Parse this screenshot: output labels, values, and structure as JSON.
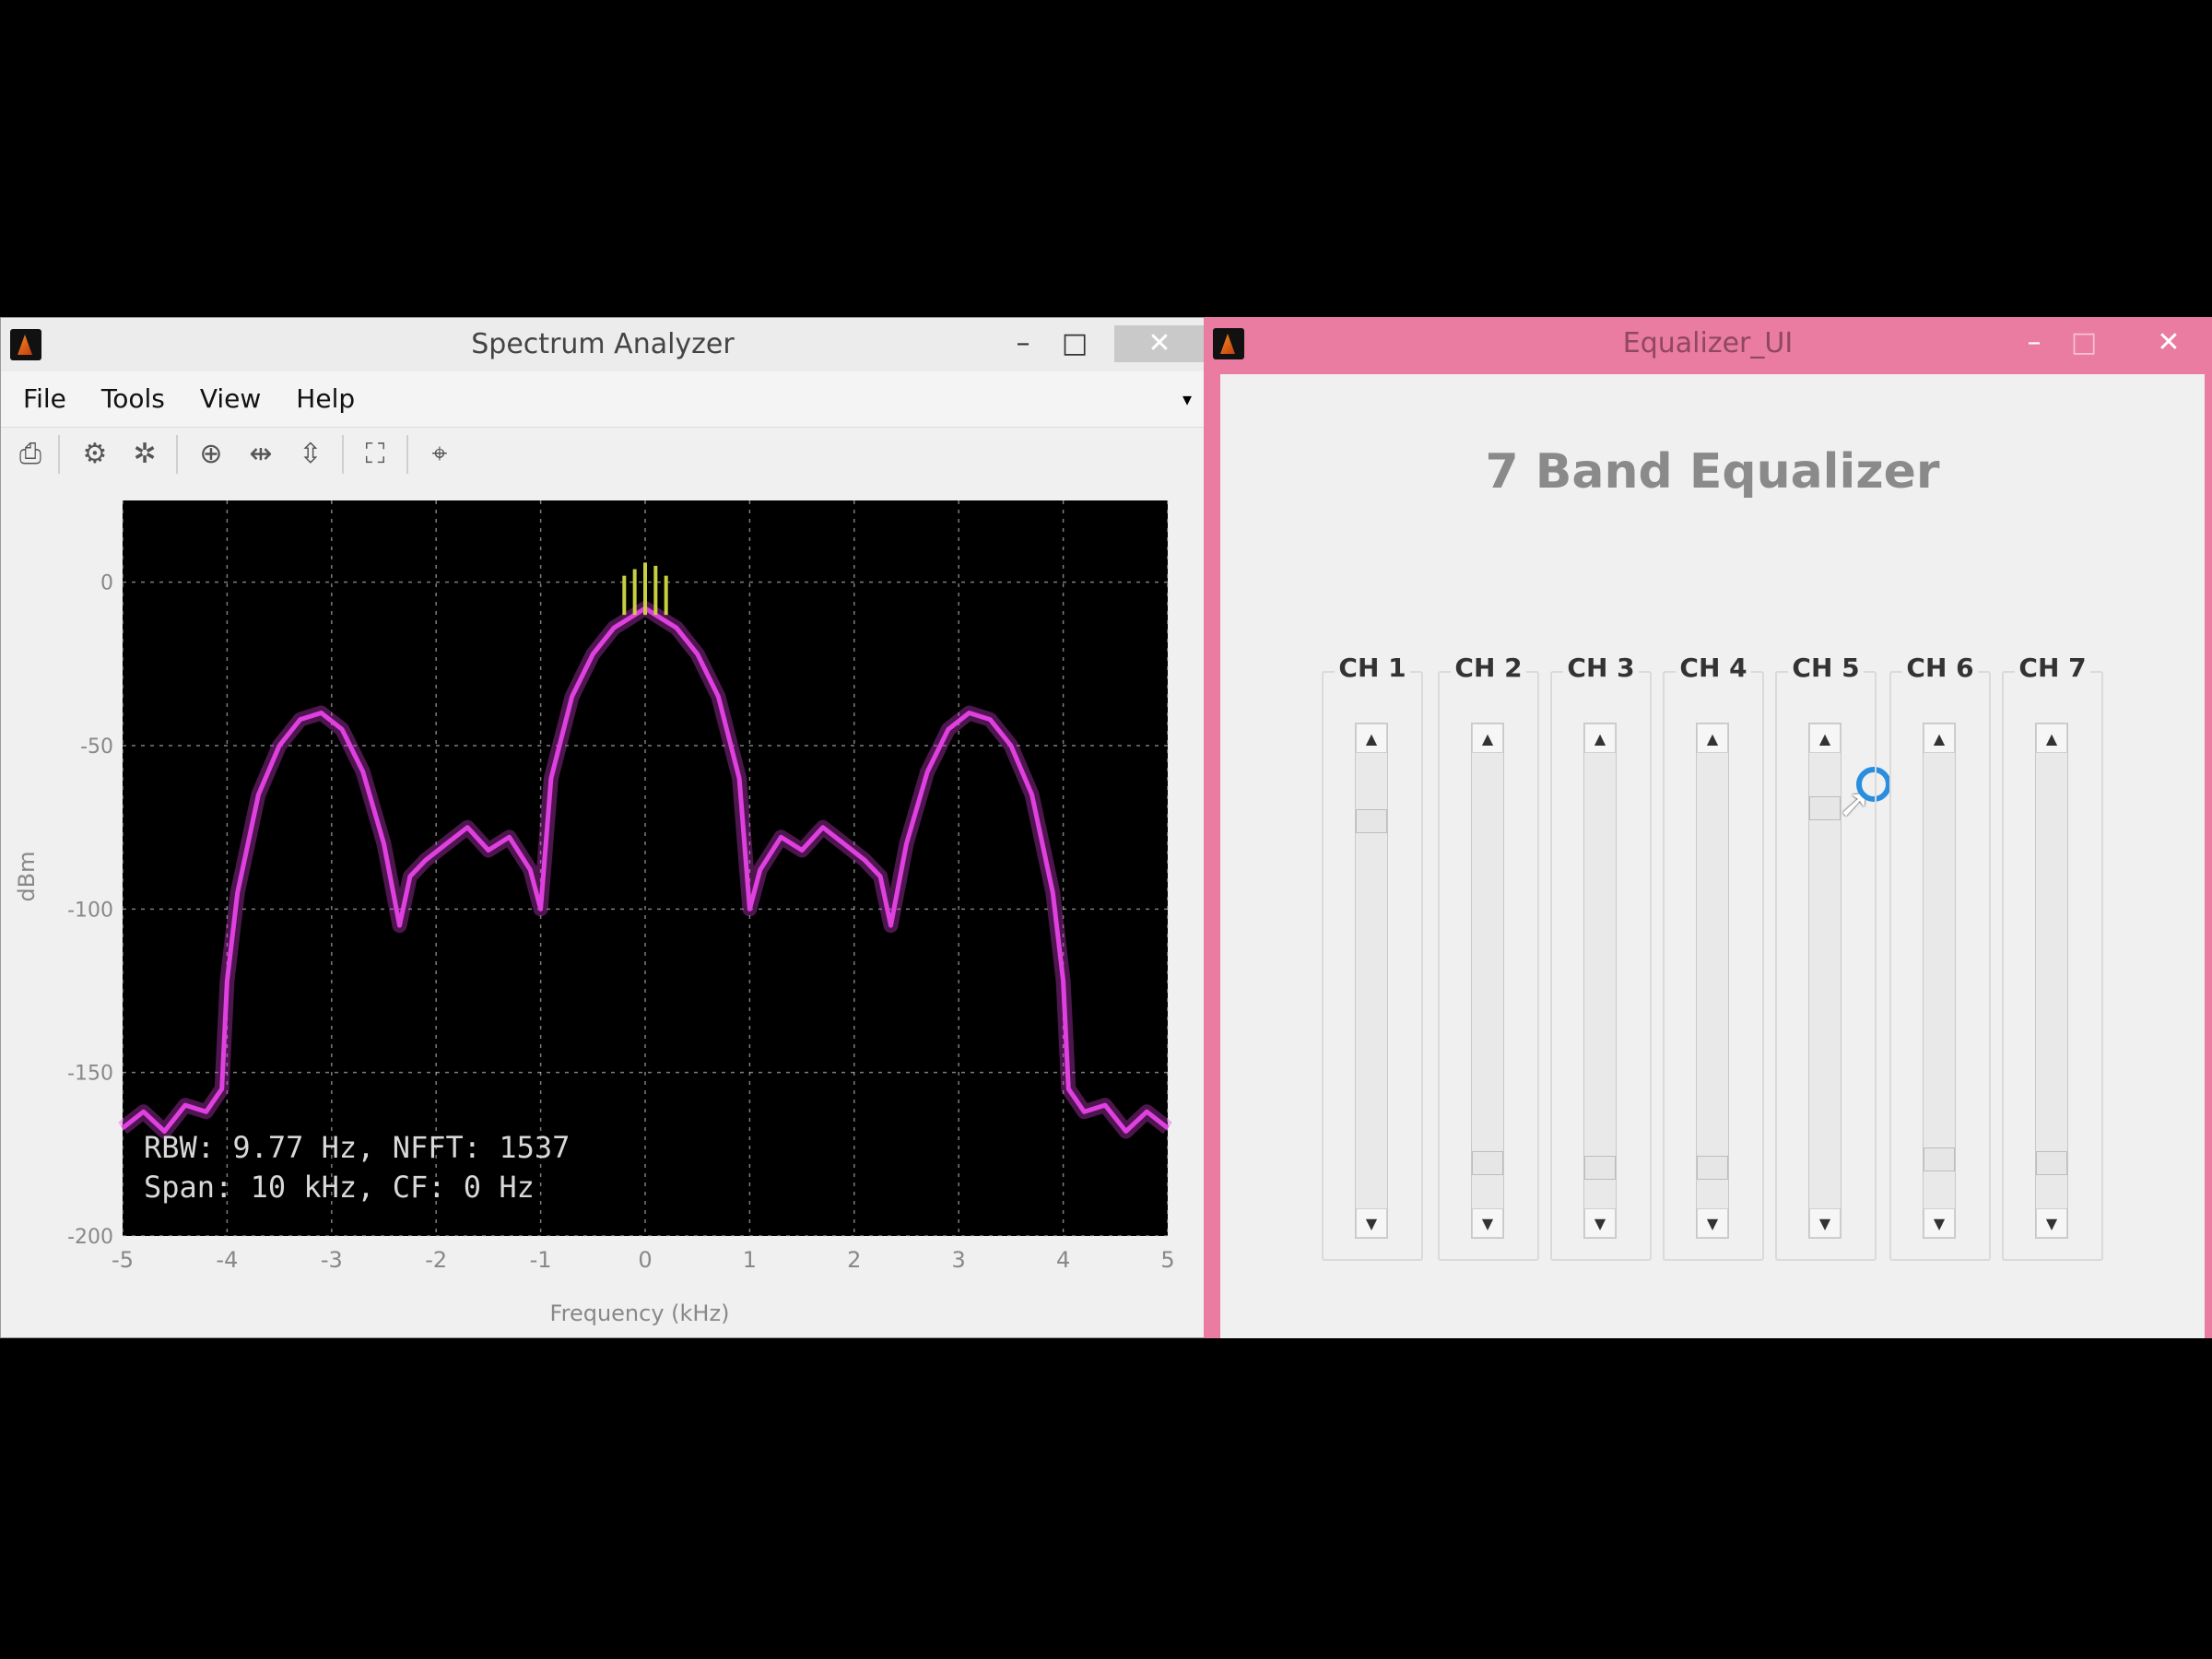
{
  "spectrum_window": {
    "title": "Spectrum Analyzer",
    "controls": {
      "minimize": "–",
      "maximize": "□",
      "close": "✕"
    },
    "menu": [
      "File",
      "Tools",
      "View",
      "Help"
    ],
    "menu_overflow": "▾",
    "toolbar": [
      {
        "name": "print-icon",
        "glyph": "⎙"
      },
      {
        "name": "settings-icon",
        "glyph": "⚙"
      },
      {
        "name": "gear-icon",
        "glyph": "✲"
      },
      {
        "name": "zoom-in-icon",
        "glyph": "⊕"
      },
      {
        "name": "zoom-x-icon",
        "glyph": "⇹"
      },
      {
        "name": "zoom-y-icon",
        "glyph": "⇳"
      },
      {
        "name": "autoscale-icon",
        "glyph": "⛶"
      },
      {
        "name": "data-cursor-icon",
        "glyph": "⌖"
      }
    ]
  },
  "chart_data": {
    "type": "line",
    "xlabel": "Frequency (kHz)",
    "ylabel": "dBm",
    "xlim": [
      -5,
      5
    ],
    "ylim": [
      -200,
      25
    ],
    "xticks": [
      "-5",
      "-4",
      "-3",
      "-2",
      "-1",
      "0",
      "1",
      "2",
      "3",
      "4",
      "5"
    ],
    "yticks": [
      {
        "v": 0,
        "label": "0"
      },
      {
        "v": -50,
        "label": "-50"
      },
      {
        "v": -100,
        "label": "-100"
      },
      {
        "v": -150,
        "label": "-150"
      },
      {
        "v": -200,
        "label": "-200"
      }
    ],
    "grid": true,
    "background": "#000000",
    "series_color": "#e040e0",
    "highlight_color": "#c8d040",
    "annotation": [
      "RBW: 9.77 Hz, NFFT: 1537",
      "Span: 10 kHz, CF: 0 Hz"
    ],
    "x": [
      -5.0,
      -4.8,
      -4.6,
      -4.4,
      -4.2,
      -4.05,
      -4.0,
      -3.9,
      -3.7,
      -3.5,
      -3.3,
      -3.1,
      -2.9,
      -2.7,
      -2.5,
      -2.35,
      -2.25,
      -2.1,
      -1.9,
      -1.7,
      -1.5,
      -1.3,
      -1.1,
      -1.0,
      -0.9,
      -0.7,
      -0.5,
      -0.3,
      -0.1,
      0.0,
      0.1,
      0.3,
      0.5,
      0.7,
      0.9,
      1.0,
      1.1,
      1.3,
      1.5,
      1.7,
      1.9,
      2.1,
      2.25,
      2.35,
      2.5,
      2.7,
      2.9,
      3.1,
      3.3,
      3.5,
      3.7,
      3.9,
      4.0,
      4.05,
      4.2,
      4.4,
      4.6,
      4.8,
      5.0
    ],
    "y": [
      -167,
      -162,
      -168,
      -160,
      -162,
      -155,
      -122,
      -95,
      -65,
      -50,
      -42,
      -40,
      -45,
      -58,
      -80,
      -105,
      -90,
      -85,
      -80,
      -75,
      -82,
      -78,
      -88,
      -100,
      -60,
      -35,
      -22,
      -14,
      -10,
      -8,
      -10,
      -14,
      -22,
      -35,
      -60,
      -100,
      -88,
      -78,
      -82,
      -75,
      -80,
      -85,
      -90,
      -105,
      -80,
      -58,
      -45,
      -40,
      -42,
      -50,
      -65,
      -95,
      -122,
      -155,
      -162,
      -160,
      -168,
      -162,
      -167
    ],
    "peaks_x": [
      -0.2,
      -0.1,
      0.0,
      0.1,
      0.2
    ],
    "peaks_y": [
      2,
      4,
      6,
      5,
      2
    ]
  },
  "equalizer_window": {
    "title": "Equalizer_UI",
    "controls": {
      "minimize": "–",
      "maximize": "□",
      "close": "✕"
    },
    "heading": "7 Band Equalizer",
    "channels": [
      {
        "label": "CH 1",
        "level": 0.87
      },
      {
        "label": "CH 2",
        "level": 0.08
      },
      {
        "label": "CH 3",
        "level": 0.07
      },
      {
        "label": "CH 4",
        "level": 0.07
      },
      {
        "label": "CH 5",
        "level": 0.9
      },
      {
        "label": "CH 6",
        "level": 0.09
      },
      {
        "label": "CH 7",
        "level": 0.08
      }
    ],
    "arrow_up": "▲",
    "arrow_down": "▼"
  }
}
